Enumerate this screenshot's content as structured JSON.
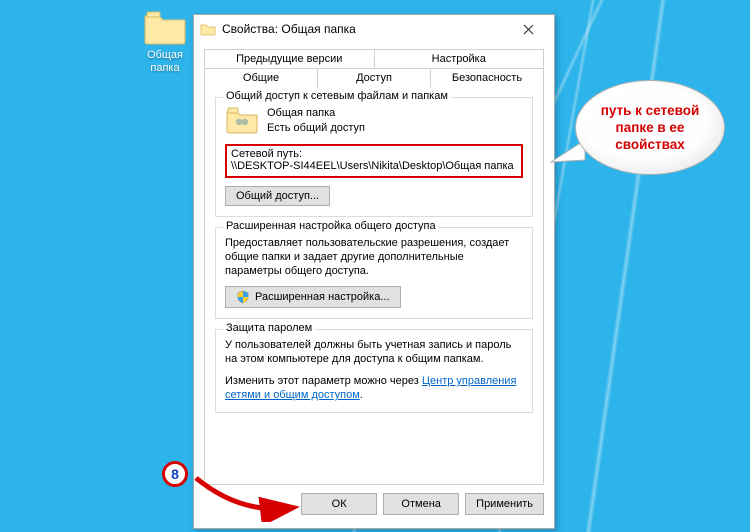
{
  "desktop": {
    "icon_label": "Общая папка"
  },
  "dialog": {
    "title": "Свойства: Общая папка",
    "tabs_top": [
      "Предыдущие версии",
      "Настройка"
    ],
    "tabs_bottom": [
      "Общие",
      "Доступ",
      "Безопасность"
    ],
    "active_tab_index": 1,
    "share_section": {
      "title": "Общий доступ к сетевым файлам и папкам",
      "folder_name": "Общая папка",
      "status": "Есть общий доступ",
      "netpath_label": "Сетевой путь:",
      "netpath_value": "\\\\DESKTOP-SI44EEL\\Users\\Nikita\\Desktop\\Общая папка",
      "share_button": "Общий доступ..."
    },
    "advanced_section": {
      "title": "Расширенная настройка общего доступа",
      "description": "Предоставляет пользовательские разрешения, создает общие папки и задает другие дополнительные параметры общего доступа.",
      "button": "Расширенная настройка..."
    },
    "password_section": {
      "title": "Защита паролем",
      "description": "У пользователей должны быть учетная запись и пароль на этом компьютере для доступа к общим папкам.",
      "change_prefix": "Изменить этот параметр можно через ",
      "link_text": "Центр управления сетями и общим доступом",
      "suffix": "."
    },
    "buttons": {
      "ok": "ОК",
      "cancel": "Отмена",
      "apply": "Применить"
    }
  },
  "callout": {
    "text": "путь к сетевой папке в ее свойствах"
  },
  "step": {
    "number": "8"
  }
}
